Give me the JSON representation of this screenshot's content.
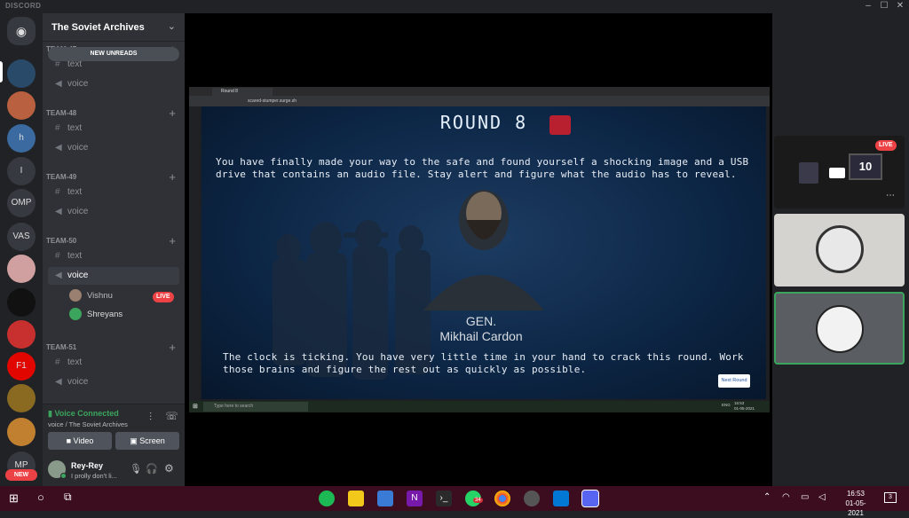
{
  "titlebar": {
    "brand": "DISCORD",
    "minimize": "–",
    "maximize": "☐",
    "close": "✕"
  },
  "guilds": [
    {
      "label": "",
      "icon": "discord-home-icon",
      "color": "#36393f"
    },
    {
      "label": "",
      "icon": "server-icon",
      "color": "#2a4a6a"
    },
    {
      "label": "",
      "icon": "server-icon",
      "color": "#b86040"
    },
    {
      "label": "h",
      "icon": "server-icon",
      "color": "#3a6aa0"
    },
    {
      "label": "I",
      "icon": "server-icon",
      "color": "#36393f"
    },
    {
      "label": "OMP",
      "icon": "server-icon",
      "color": "#36393f"
    },
    {
      "label": "VAS",
      "icon": "server-icon",
      "color": "#36393f"
    },
    {
      "label": "",
      "icon": "server-icon",
      "color": "#d0a0a0"
    },
    {
      "label": "",
      "icon": "server-icon",
      "color": "#111111"
    },
    {
      "label": "",
      "icon": "server-icon",
      "color": "#c83030"
    },
    {
      "label": "F1",
      "icon": "server-icon",
      "color": "#e10600"
    },
    {
      "label": "",
      "icon": "server-icon",
      "color": "#8a6a20"
    },
    {
      "label": "",
      "icon": "server-icon",
      "color": "#c08030"
    },
    {
      "label": "MP",
      "icon": "server-icon",
      "color": "#36393f"
    }
  ],
  "new_badge": "NEW",
  "server": {
    "name": "The Soviet Archives",
    "new_unreads": "NEW UNREADS"
  },
  "categories": [
    {
      "name": "TEAM-47",
      "channels": [
        {
          "type": "text",
          "name": "text"
        },
        {
          "type": "voice",
          "name": "voice"
        }
      ]
    },
    {
      "name": "TEAM-48",
      "channels": [
        {
          "type": "text",
          "name": "text"
        },
        {
          "type": "voice",
          "name": "voice"
        }
      ]
    },
    {
      "name": "TEAM-49",
      "channels": [
        {
          "type": "text",
          "name": "text"
        },
        {
          "type": "voice",
          "name": "voice"
        }
      ]
    },
    {
      "name": "TEAM-50",
      "channels": [
        {
          "type": "text",
          "name": "text"
        },
        {
          "type": "voice",
          "name": "voice"
        }
      ]
    },
    {
      "name": "TEAM-51",
      "channels": [
        {
          "type": "text",
          "name": "text"
        },
        {
          "type": "voice",
          "name": "voice"
        }
      ]
    }
  ],
  "voice_users": [
    {
      "name": "Vishnu",
      "live": "LIVE"
    },
    {
      "name": "Shreyans"
    }
  ],
  "voice_panel": {
    "status": "Voice Connected",
    "location": "voice / The Soviet Archives",
    "video": "Video",
    "screen": "Screen"
  },
  "user": {
    "name": "Rey-Rey",
    "status": "I prolly don't li..."
  },
  "shared_screen": {
    "tab_title": "Round 8",
    "url": "scared-stumper.surge.sh",
    "round_title": "ROUND 8",
    "intro": "You have finally made your way to the safe and found yourself a shocking image and a USB drive that contains an audio file. Stay alert and figure what the audio has to reveal.",
    "gen_name_1": "GEN.",
    "gen_name_2": "Mikhail Cardon",
    "outro": "The clock is ticking. You have very little time in your hand to crack this round. Work those brains and figure the rest out as quickly as possible.",
    "next_button": "Next Round",
    "search_placeholder": "Type here to search",
    "clock_time": "16:53",
    "clock_date": "01-05-2021",
    "lang": "ENG"
  },
  "tiles": {
    "live": "LIVE",
    "screen_number": "10"
  },
  "taskbar": {
    "time": "16:53",
    "date": "01-05-2021",
    "whatsapp_badge": "34",
    "notif_count": "3"
  }
}
